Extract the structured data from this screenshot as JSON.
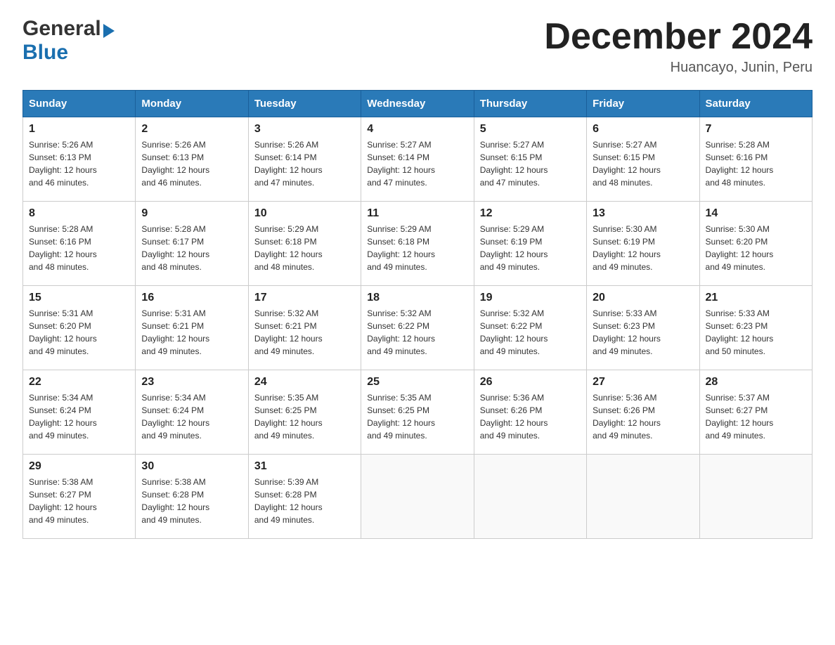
{
  "header": {
    "logo_general": "General",
    "logo_blue": "Blue",
    "month_title": "December 2024",
    "subtitle": "Huancayo, Junin, Peru"
  },
  "days_of_week": [
    "Sunday",
    "Monday",
    "Tuesday",
    "Wednesday",
    "Thursday",
    "Friday",
    "Saturday"
  ],
  "weeks": [
    [
      {
        "day": "1",
        "sunrise": "5:26 AM",
        "sunset": "6:13 PM",
        "daylight": "12 hours and 46 minutes."
      },
      {
        "day": "2",
        "sunrise": "5:26 AM",
        "sunset": "6:13 PM",
        "daylight": "12 hours and 46 minutes."
      },
      {
        "day": "3",
        "sunrise": "5:26 AM",
        "sunset": "6:14 PM",
        "daylight": "12 hours and 47 minutes."
      },
      {
        "day": "4",
        "sunrise": "5:27 AM",
        "sunset": "6:14 PM",
        "daylight": "12 hours and 47 minutes."
      },
      {
        "day": "5",
        "sunrise": "5:27 AM",
        "sunset": "6:15 PM",
        "daylight": "12 hours and 47 minutes."
      },
      {
        "day": "6",
        "sunrise": "5:27 AM",
        "sunset": "6:15 PM",
        "daylight": "12 hours and 48 minutes."
      },
      {
        "day": "7",
        "sunrise": "5:28 AM",
        "sunset": "6:16 PM",
        "daylight": "12 hours and 48 minutes."
      }
    ],
    [
      {
        "day": "8",
        "sunrise": "5:28 AM",
        "sunset": "6:16 PM",
        "daylight": "12 hours and 48 minutes."
      },
      {
        "day": "9",
        "sunrise": "5:28 AM",
        "sunset": "6:17 PM",
        "daylight": "12 hours and 48 minutes."
      },
      {
        "day": "10",
        "sunrise": "5:29 AM",
        "sunset": "6:18 PM",
        "daylight": "12 hours and 48 minutes."
      },
      {
        "day": "11",
        "sunrise": "5:29 AM",
        "sunset": "6:18 PM",
        "daylight": "12 hours and 49 minutes."
      },
      {
        "day": "12",
        "sunrise": "5:29 AM",
        "sunset": "6:19 PM",
        "daylight": "12 hours and 49 minutes."
      },
      {
        "day": "13",
        "sunrise": "5:30 AM",
        "sunset": "6:19 PM",
        "daylight": "12 hours and 49 minutes."
      },
      {
        "day": "14",
        "sunrise": "5:30 AM",
        "sunset": "6:20 PM",
        "daylight": "12 hours and 49 minutes."
      }
    ],
    [
      {
        "day": "15",
        "sunrise": "5:31 AM",
        "sunset": "6:20 PM",
        "daylight": "12 hours and 49 minutes."
      },
      {
        "day": "16",
        "sunrise": "5:31 AM",
        "sunset": "6:21 PM",
        "daylight": "12 hours and 49 minutes."
      },
      {
        "day": "17",
        "sunrise": "5:32 AM",
        "sunset": "6:21 PM",
        "daylight": "12 hours and 49 minutes."
      },
      {
        "day": "18",
        "sunrise": "5:32 AM",
        "sunset": "6:22 PM",
        "daylight": "12 hours and 49 minutes."
      },
      {
        "day": "19",
        "sunrise": "5:32 AM",
        "sunset": "6:22 PM",
        "daylight": "12 hours and 49 minutes."
      },
      {
        "day": "20",
        "sunrise": "5:33 AM",
        "sunset": "6:23 PM",
        "daylight": "12 hours and 49 minutes."
      },
      {
        "day": "21",
        "sunrise": "5:33 AM",
        "sunset": "6:23 PM",
        "daylight": "12 hours and 50 minutes."
      }
    ],
    [
      {
        "day": "22",
        "sunrise": "5:34 AM",
        "sunset": "6:24 PM",
        "daylight": "12 hours and 49 minutes."
      },
      {
        "day": "23",
        "sunrise": "5:34 AM",
        "sunset": "6:24 PM",
        "daylight": "12 hours and 49 minutes."
      },
      {
        "day": "24",
        "sunrise": "5:35 AM",
        "sunset": "6:25 PM",
        "daylight": "12 hours and 49 minutes."
      },
      {
        "day": "25",
        "sunrise": "5:35 AM",
        "sunset": "6:25 PM",
        "daylight": "12 hours and 49 minutes."
      },
      {
        "day": "26",
        "sunrise": "5:36 AM",
        "sunset": "6:26 PM",
        "daylight": "12 hours and 49 minutes."
      },
      {
        "day": "27",
        "sunrise": "5:36 AM",
        "sunset": "6:26 PM",
        "daylight": "12 hours and 49 minutes."
      },
      {
        "day": "28",
        "sunrise": "5:37 AM",
        "sunset": "6:27 PM",
        "daylight": "12 hours and 49 minutes."
      }
    ],
    [
      {
        "day": "29",
        "sunrise": "5:38 AM",
        "sunset": "6:27 PM",
        "daylight": "12 hours and 49 minutes."
      },
      {
        "day": "30",
        "sunrise": "5:38 AM",
        "sunset": "6:28 PM",
        "daylight": "12 hours and 49 minutes."
      },
      {
        "day": "31",
        "sunrise": "5:39 AM",
        "sunset": "6:28 PM",
        "daylight": "12 hours and 49 minutes."
      },
      null,
      null,
      null,
      null
    ]
  ],
  "labels": {
    "sunrise": "Sunrise:",
    "sunset": "Sunset:",
    "daylight": "Daylight:"
  }
}
